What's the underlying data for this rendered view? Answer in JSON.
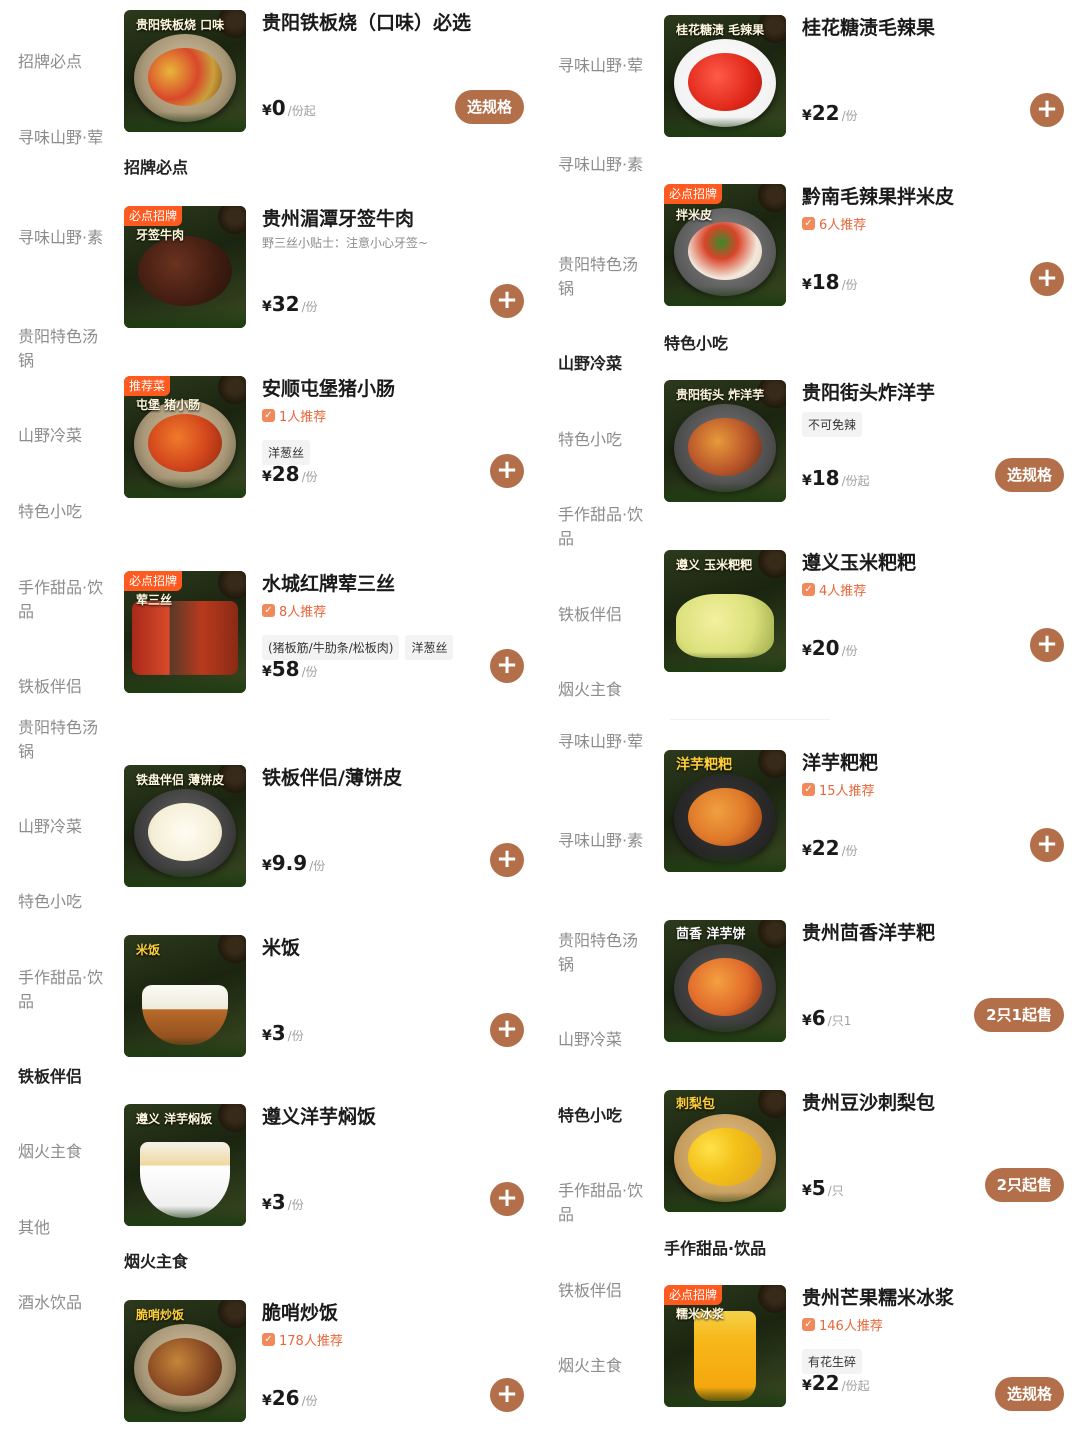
{
  "left": {
    "sidebar": [
      {
        "label": "招牌必点",
        "active": false
      },
      {
        "label": "寻味山野·荤",
        "active": false
      },
      {
        "label": "寻味山野·素",
        "active": false
      },
      {
        "label": "贵阳特色汤锅",
        "active": false
      },
      {
        "label": "山野冷菜",
        "active": false
      },
      {
        "label": "特色小吃",
        "active": false
      },
      {
        "label": "手作甜品·饮品",
        "active": false
      },
      {
        "label": "铁板伴侣",
        "active": false
      },
      {
        "label": "贵阳特色汤锅",
        "active": false
      },
      {
        "label": "山野冷菜",
        "active": false
      },
      {
        "label": "特色小吃",
        "active": false
      },
      {
        "label": "手作甜品·饮品",
        "active": false
      },
      {
        "label": "铁板伴侣",
        "active": true
      },
      {
        "label": "烟火主食",
        "active": false
      },
      {
        "label": "其他",
        "active": false
      },
      {
        "label": "酒水饮品",
        "active": false
      }
    ],
    "categories": [
      "招牌必点",
      "烟火主食"
    ],
    "items": [
      {
        "name": "贵阳铁板烧（口味）必选",
        "thumb_title": "贵阳铁板烧 口味",
        "tag": "",
        "rec": "",
        "desc": "",
        "chips": [],
        "price": "0",
        "unit": "/份起",
        "action": "选规格"
      },
      {
        "name": "贵州湄潭牙签牛肉",
        "thumb_title": "牙签牛肉",
        "tag": "必点招牌",
        "rec": "",
        "desc": "野三丝小贴士：注意小心牙签~",
        "chips": [],
        "price": "32",
        "unit": "/份",
        "action": "+"
      },
      {
        "name": "安顺屯堡猪小肠",
        "thumb_title": "屯堡 猪小肠",
        "tag": "推荐菜",
        "rec": "1人推荐",
        "desc": "",
        "chips": [
          "洋葱丝"
        ],
        "price": "28",
        "unit": "/份",
        "action": "+"
      },
      {
        "name": "水城红牌荤三丝",
        "thumb_title": "荤三丝",
        "tag": "必点招牌",
        "rec": "8人推荐",
        "desc": "",
        "chips": [
          "(猪板筋/牛肋条/松板肉)",
          "洋葱丝"
        ],
        "price": "58",
        "unit": "/份",
        "action": "+"
      },
      {
        "name": "铁板伴侣/薄饼皮",
        "thumb_title": "铁盘伴侣 薄饼皮",
        "tag": "",
        "rec": "",
        "desc": "",
        "chips": [],
        "price": "9.9",
        "unit": "/份",
        "action": "+"
      },
      {
        "name": "米饭",
        "thumb_title": "米饭",
        "tag": "",
        "rec": "",
        "desc": "",
        "chips": [],
        "price": "3",
        "unit": "/份",
        "action": "+"
      },
      {
        "name": "遵义洋芋焖饭",
        "thumb_title": "遵义 洋芋焖饭",
        "tag": "",
        "rec": "",
        "desc": "",
        "chips": [],
        "price": "3",
        "unit": "/份",
        "action": "+"
      },
      {
        "name": "脆哨炒饭",
        "thumb_title": "脆哨炒饭",
        "tag": "",
        "rec": "178人推荐",
        "desc": "",
        "chips": [],
        "price": "26",
        "unit": "/份",
        "action": "+"
      }
    ]
  },
  "right": {
    "sidebar": [
      {
        "label": "寻味山野·荤",
        "active": false
      },
      {
        "label": "寻味山野·素",
        "active": false
      },
      {
        "label": "贵阳特色汤锅",
        "active": false
      },
      {
        "label": "山野冷菜",
        "active": true
      },
      {
        "label": "特色小吃",
        "active": false
      },
      {
        "label": "手作甜品·饮品",
        "active": false
      },
      {
        "label": "铁板伴侣",
        "active": false
      },
      {
        "label": "烟火主食",
        "active": false
      },
      {
        "label": "寻味山野·荤",
        "active": false
      },
      {
        "label": "寻味山野·素",
        "active": false
      },
      {
        "label": "贵阳特色汤锅",
        "active": false
      },
      {
        "label": "山野冷菜",
        "active": false
      },
      {
        "label": "特色小吃",
        "active": true
      },
      {
        "label": "手作甜品·饮品",
        "active": false
      },
      {
        "label": "铁板伴侣",
        "active": false
      },
      {
        "label": "烟火主食",
        "active": false
      }
    ],
    "categories": [
      "特色小吃",
      "手作甜品·饮品"
    ],
    "items": [
      {
        "name": "桂花糖渍毛辣果",
        "thumb_title": "桂花糖渍 毛辣果",
        "tag": "",
        "rec": "",
        "desc": "",
        "chips": [],
        "price": "22",
        "unit": "/份",
        "action": "+"
      },
      {
        "name": "黔南毛辣果拌米皮",
        "thumb_title": "拌米皮",
        "tag": "必点招牌",
        "rec": "6人推荐",
        "desc": "",
        "chips": [],
        "price": "18",
        "unit": "/份",
        "action": "+"
      },
      {
        "name": "贵阳街头炸洋芋",
        "thumb_title": "贵阳街头 炸洋芋",
        "tag": "",
        "rec": "",
        "desc": "",
        "chips": [
          "不可免辣"
        ],
        "price": "18",
        "unit": "/份起",
        "action": "选规格"
      },
      {
        "name": "遵义玉米粑粑",
        "thumb_title": "遵义 玉米粑粑",
        "tag": "",
        "rec": "4人推荐",
        "desc": "",
        "chips": [],
        "price": "20",
        "unit": "/份",
        "action": "+"
      },
      {
        "name": "洋芋粑粑",
        "thumb_title": "洋芋粑粑",
        "tag": "",
        "rec": "15人推荐",
        "desc": "",
        "chips": [],
        "price": "22",
        "unit": "/份",
        "action": "+"
      },
      {
        "name": "贵州茴香洋芋粑",
        "thumb_title": "茴香 洋芋饼",
        "tag": "",
        "rec": "",
        "desc": "",
        "chips": [],
        "price": "6",
        "unit": "/只1",
        "action": "2只1起售"
      },
      {
        "name": "贵州豆沙刺梨包",
        "thumb_title": "刺梨包",
        "tag": "",
        "rec": "",
        "desc": "",
        "chips": [],
        "price": "5",
        "unit": "/只",
        "action": "2只起售"
      },
      {
        "name": "贵州芒果糯米冰浆",
        "thumb_title": "糯米冰浆",
        "tag": "必点招牌",
        "rec": "146人推荐",
        "desc": "",
        "chips": [
          "有花生碎"
        ],
        "price": "22",
        "unit": "/份起",
        "action": "选规格"
      }
    ]
  },
  "currency": "¥",
  "colors": {
    "accent": "#b26f4a",
    "tag": "#ff5a1f",
    "rec": "#e8663a"
  }
}
